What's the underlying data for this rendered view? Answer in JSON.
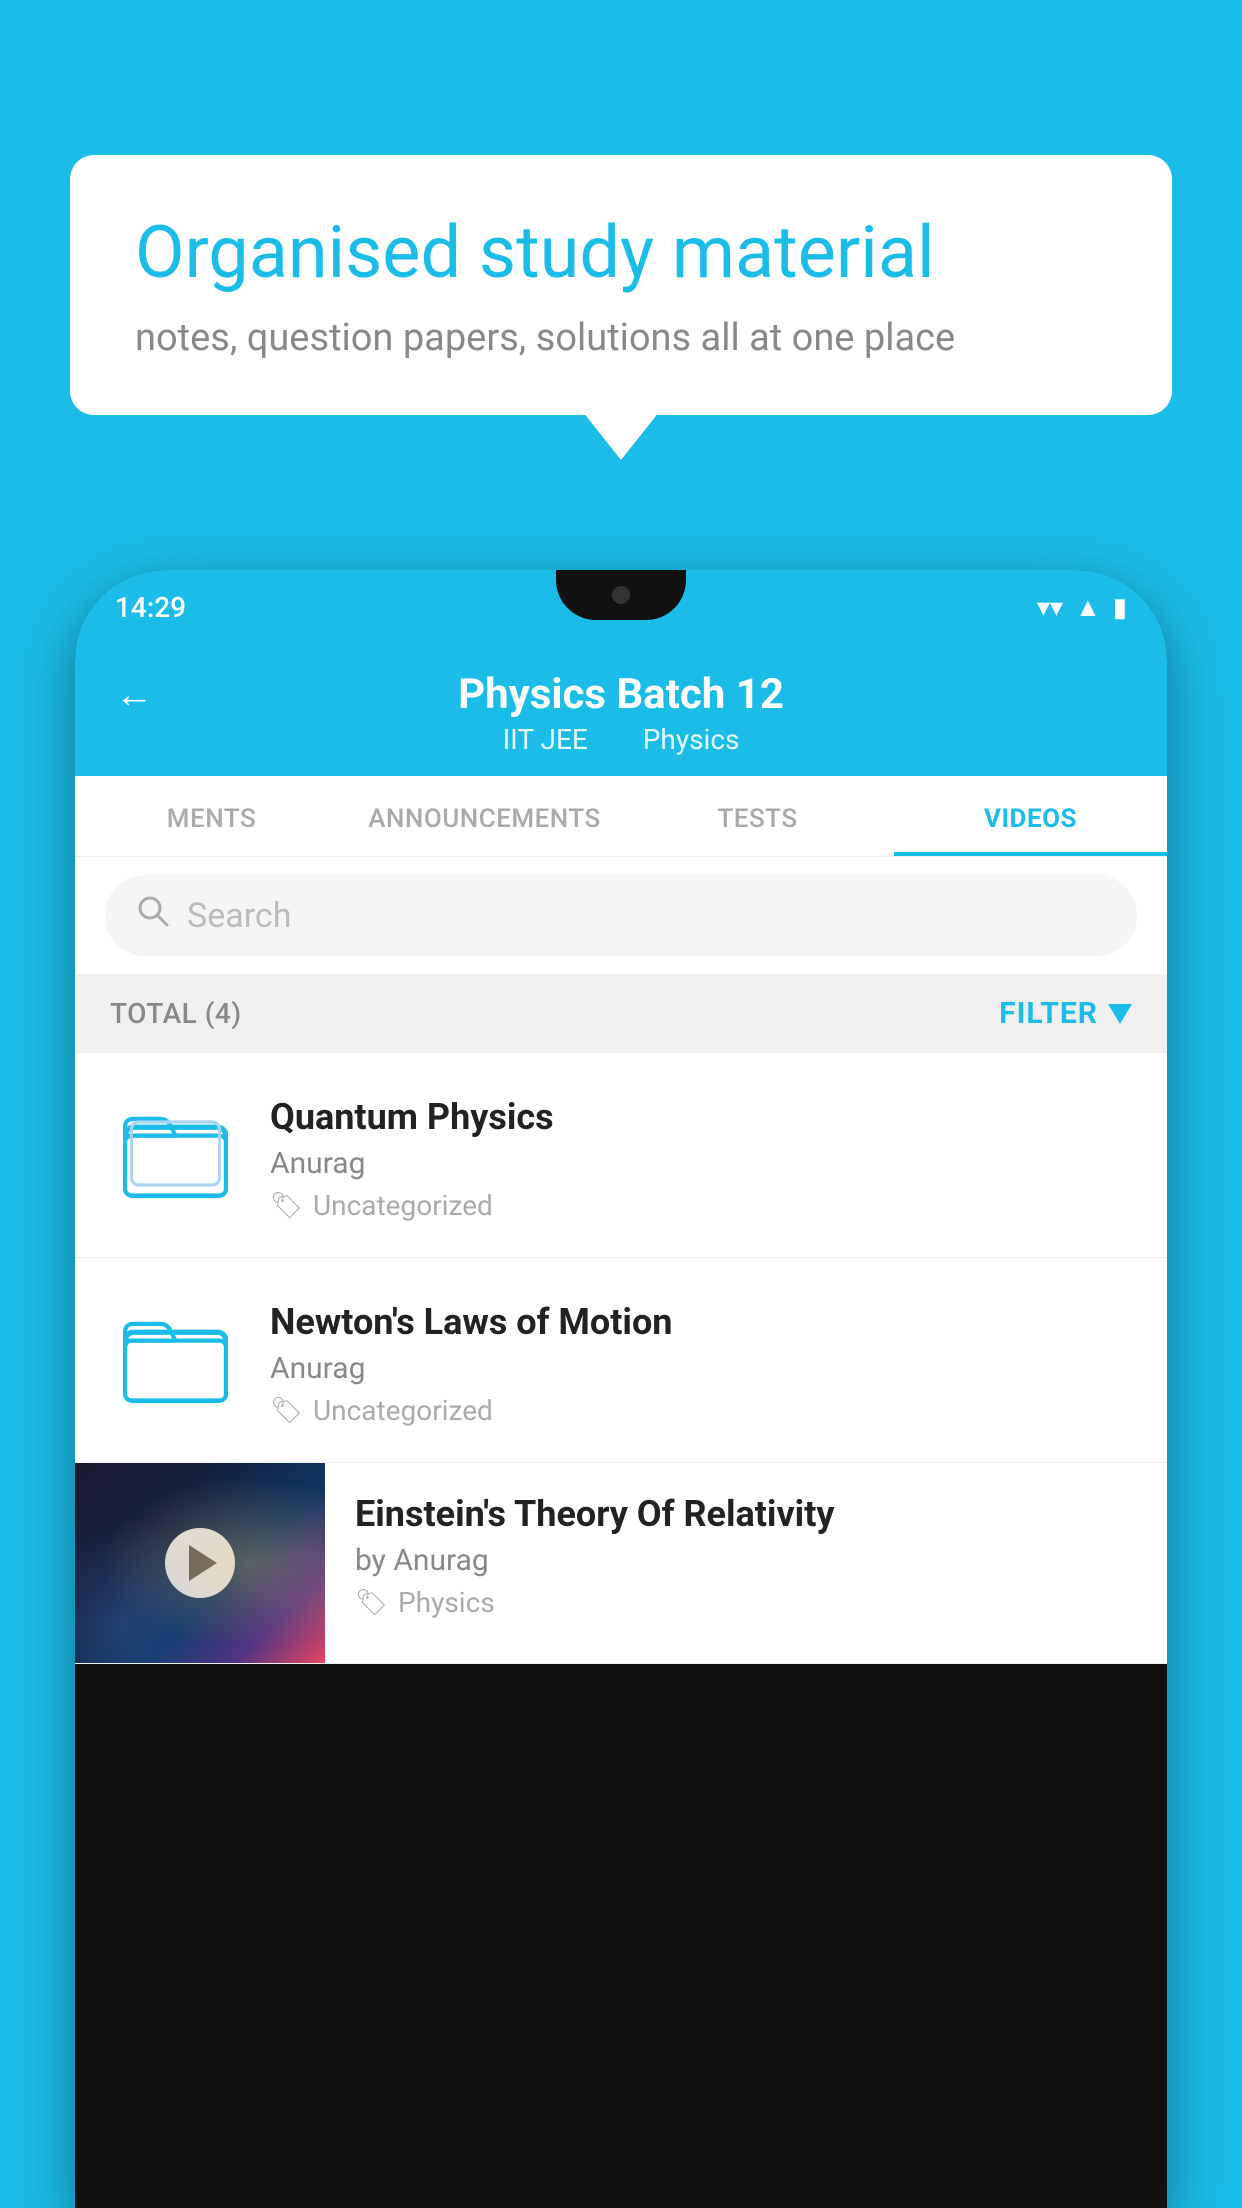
{
  "background": {
    "color": "#1bbde8"
  },
  "bubble": {
    "title": "Organised study material",
    "subtitle": "notes, question papers, solutions all at one place"
  },
  "phone": {
    "status_bar": {
      "time": "14:29"
    },
    "header": {
      "title": "Physics Batch 12",
      "subtitle_part1": "IIT JEE",
      "subtitle_part2": "Physics"
    },
    "tabs": [
      {
        "label": "MENTS",
        "active": false
      },
      {
        "label": "ANNOUNCEMENTS",
        "active": false
      },
      {
        "label": "TESTS",
        "active": false
      },
      {
        "label": "VIDEOS",
        "active": true
      }
    ],
    "search": {
      "placeholder": "Search"
    },
    "filter_bar": {
      "total_label": "TOTAL (4)",
      "filter_label": "FILTER"
    },
    "videos": [
      {
        "id": 1,
        "title": "Quantum Physics",
        "author": "Anurag",
        "tag": "Uncategorized",
        "has_thumbnail": false
      },
      {
        "id": 2,
        "title": "Newton's Laws of Motion",
        "author": "Anurag",
        "tag": "Uncategorized",
        "has_thumbnail": false
      },
      {
        "id": 3,
        "title": "Einstein's Theory Of Relativity",
        "author": "by Anurag",
        "tag": "Physics",
        "has_thumbnail": true
      }
    ]
  }
}
